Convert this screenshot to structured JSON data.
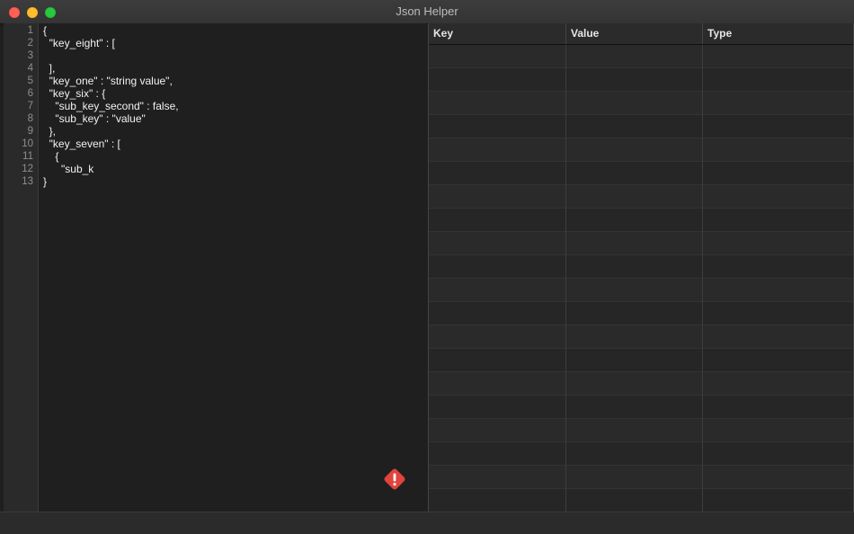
{
  "window": {
    "title": "Json Helper"
  },
  "editor": {
    "line_numbers": [
      "1",
      "2",
      "3",
      "4",
      "5",
      "6",
      "7",
      "8",
      "9",
      "10",
      "11",
      "12",
      "13"
    ],
    "lines": [
      "{",
      "  \"key_eight\" : [",
      "",
      "  ],",
      "  \"key_one\" : \"string value\",",
      "  \"key_six\" : {",
      "    \"sub_key_second\" : false,",
      "    \"sub_key\" : \"value\"",
      "  },",
      "  \"key_seven\" : [",
      "    {",
      "      \"sub_k",
      "}"
    ],
    "error_icon": "exclamation-diamond-icon",
    "error_color": "#e0443c"
  },
  "table": {
    "headers": {
      "key": "Key",
      "value": "Value",
      "type": "Type"
    },
    "rows": []
  },
  "colors": {
    "close": "#fe5f57",
    "minimize": "#febc2e",
    "maximize": "#28c840"
  }
}
